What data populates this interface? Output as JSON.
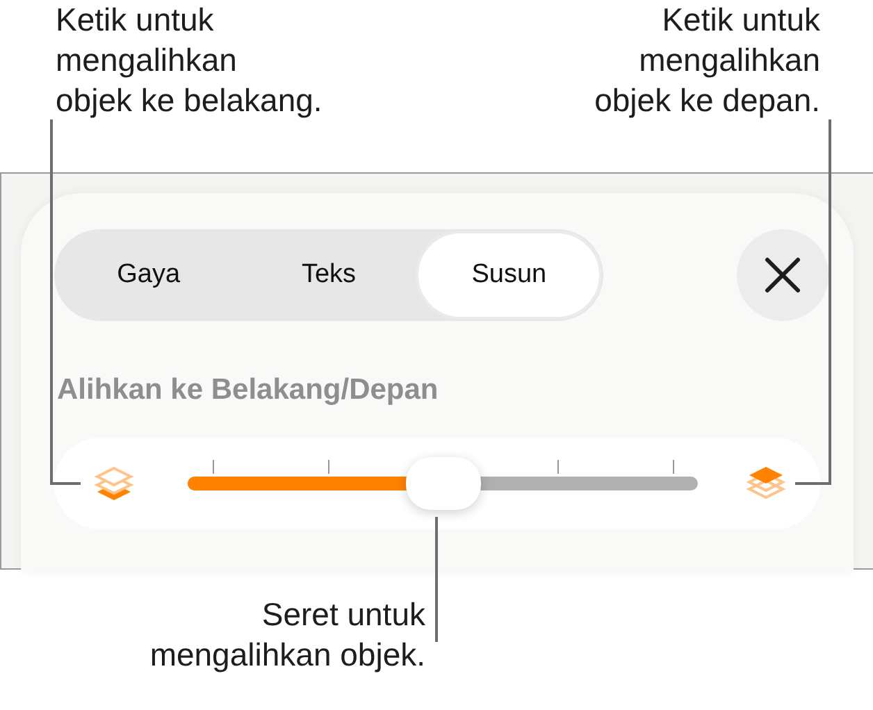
{
  "callouts": [
    {
      "text": "Ketik untuk\nmengalihkan\nobjek ke belakang."
    },
    {
      "text": "Ketik untuk\nmengalihkan\nobjek ke depan."
    },
    {
      "text": "Seret untuk\nmengalihkan objek."
    }
  ],
  "tabs": [
    {
      "label": "Gaya",
      "selected": false
    },
    {
      "label": "Teks",
      "selected": false
    },
    {
      "label": "Susun",
      "selected": true
    }
  ],
  "section_title": "Alihkan ke Belakang/Depan",
  "slider": {
    "level": 0.5
  }
}
